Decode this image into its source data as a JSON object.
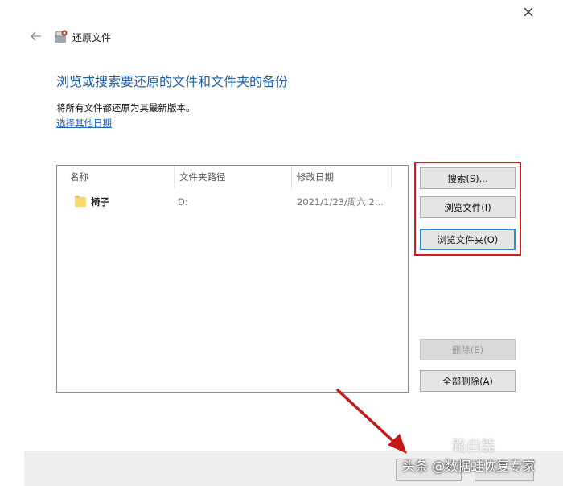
{
  "window": {
    "title": "还原文件"
  },
  "header": {
    "heading": "浏览或搜索要还原的文件和文件夹的备份",
    "restore_note": "将所有文件都还原为其最新版本。",
    "other_date_link": "选择其他日期"
  },
  "file_list": {
    "columns": [
      "名称",
      "文件夹路径",
      "修改日期"
    ],
    "rows": [
      {
        "name": "椅子",
        "path": "D:",
        "modified": "2021/1/23/周六 2..."
      }
    ]
  },
  "actions": {
    "search": "搜索(S)...",
    "browse_files": "浏览文件(I)",
    "browse_folders": "浏览文件夹(O)",
    "delete": "删除(E)",
    "delete_all": "全部删除(A)"
  },
  "watermark": {
    "text": "头条 @数据蛙恢复专家",
    "logo": "路由器"
  },
  "colors": {
    "heading": "#1f5fa8",
    "link": "#1e63c6",
    "highlight": "#cc1e1e",
    "focus": "#2f86d9"
  }
}
